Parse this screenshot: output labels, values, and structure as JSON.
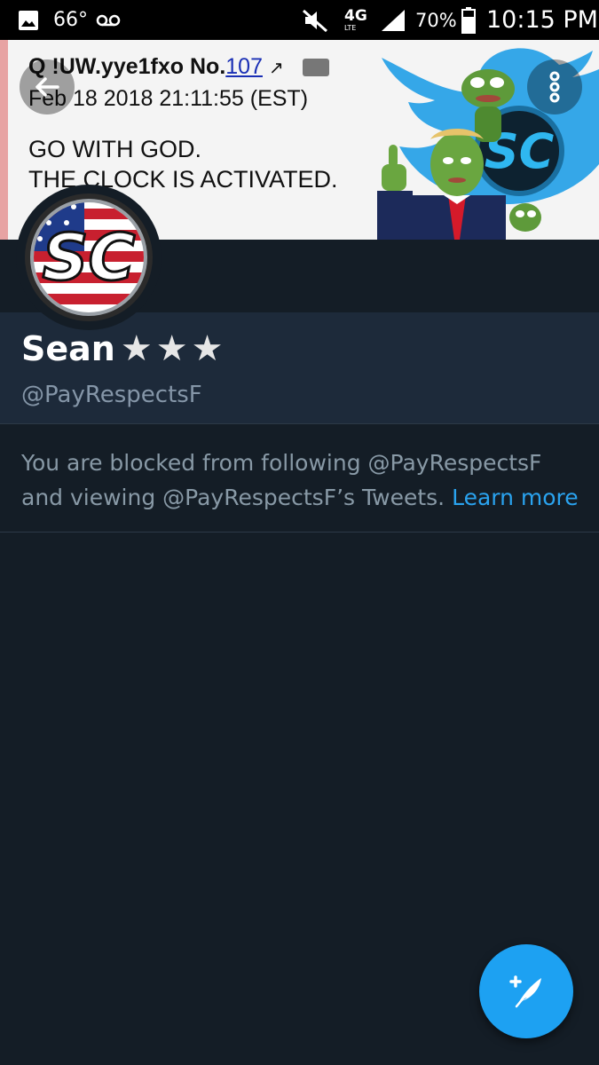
{
  "status_bar": {
    "temperature": "66°",
    "network": "4G",
    "network_sub": "LTE",
    "battery": "70%",
    "time": "10:15 PM"
  },
  "banner": {
    "post_header": "Q !UW.yye1fxo No.",
    "post_number": "107",
    "post_date": "Feb 18 2018 21:11:55 (EST)",
    "line1": "GO WITH GOD.",
    "line2": "THE CLOCK IS ACTIVATED.",
    "logo_text": "SC"
  },
  "avatar": {
    "logo_text": "SC"
  },
  "profile": {
    "name": "Sean",
    "stars": "★★★",
    "handle": "@PayRespectsF"
  },
  "blocked_notice": {
    "text": "You are blocked from following @PayRespectsF and viewing @PayRespectsF’s Tweets.",
    "link": "Learn more"
  },
  "colors": {
    "background": "#141d26",
    "panel": "#1d2a3a",
    "accent": "#1da1f2"
  },
  "icons": {
    "back": "arrow-left-icon",
    "more": "more-vertical-icon",
    "compose": "compose-tweet-icon"
  }
}
